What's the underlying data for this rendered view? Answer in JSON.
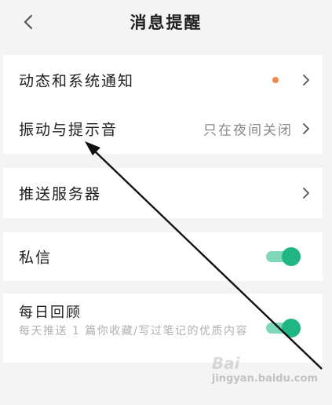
{
  "header": {
    "title": "消息提醒",
    "back_icon": "chevron-left-icon"
  },
  "section1": {
    "items": [
      {
        "label": "动态和系统通知",
        "badge_color": "#ee8a4c"
      },
      {
        "label": "振动与提示音",
        "value": "只在夜间关闭"
      }
    ]
  },
  "section2": {
    "items": [
      {
        "label": "推送服务器"
      }
    ]
  },
  "section3": {
    "items": [
      {
        "label": "私信",
        "enabled": true
      }
    ]
  },
  "section4": {
    "items": [
      {
        "label": "每日回顾",
        "description": "每天推送 1 篇你收藏/写过笔记的优质内容",
        "enabled": true
      }
    ]
  },
  "colors": {
    "accent_toggle": "#20b585",
    "toggle_track": "#7fd8b8",
    "background": "#f4f4f4",
    "card": "#ffffff"
  },
  "watermark": {
    "text": "Bai",
    "subtext": "jingyan.baidu.com"
  }
}
